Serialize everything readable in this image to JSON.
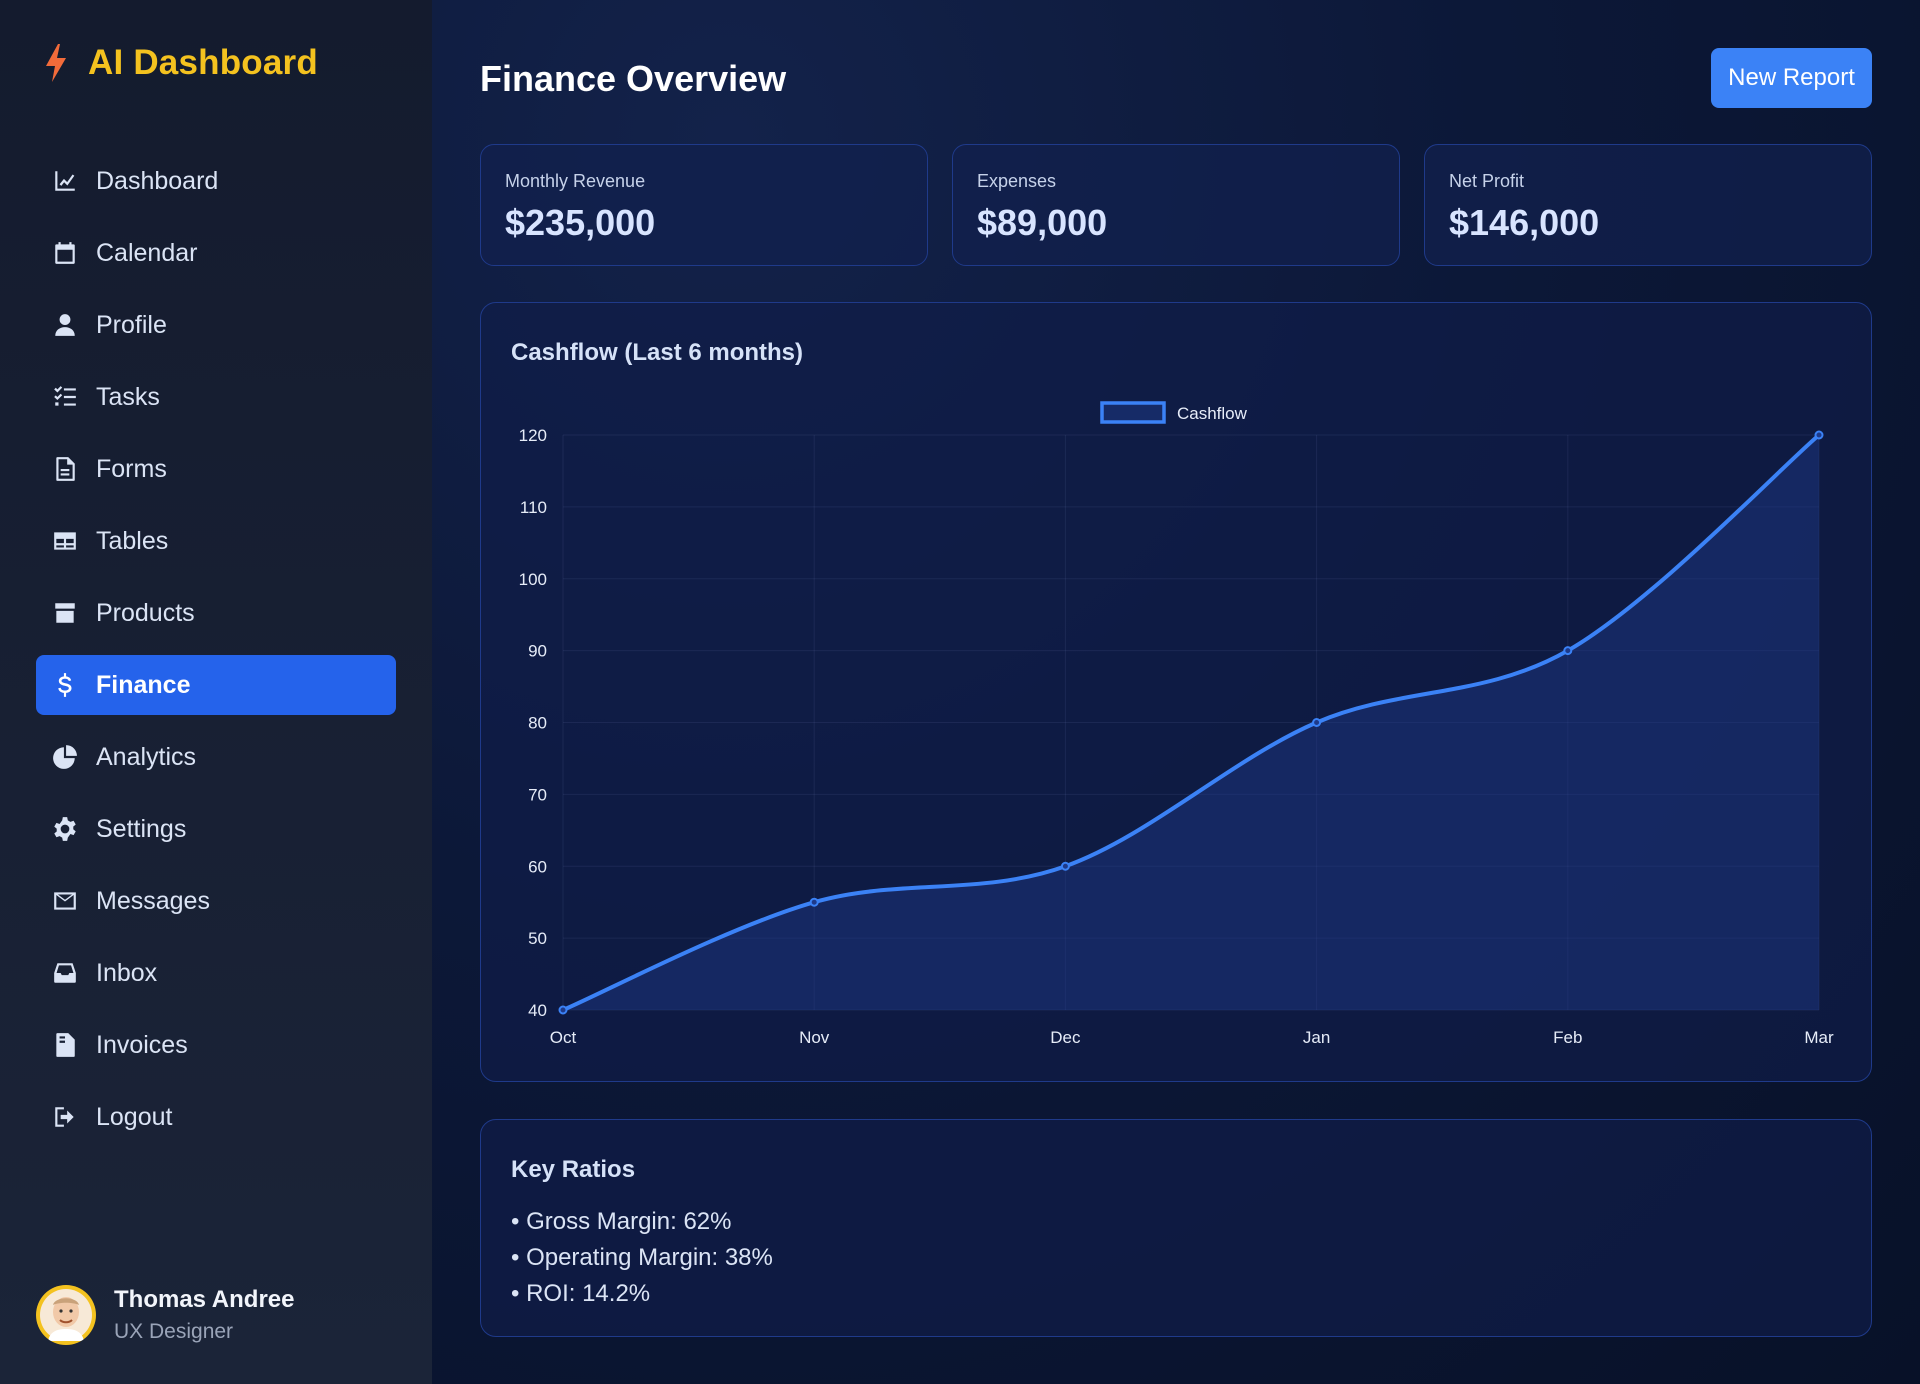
{
  "brand": {
    "title": "AI Dashboard",
    "icon": "bolt-icon",
    "color": "#f4c21f"
  },
  "sidebar": {
    "items": [
      {
        "label": "Dashboard",
        "icon": "chart-line-icon",
        "active": false
      },
      {
        "label": "Calendar",
        "icon": "calendar-icon",
        "active": false
      },
      {
        "label": "Profile",
        "icon": "user-icon",
        "active": false
      },
      {
        "label": "Tasks",
        "icon": "list-check-icon",
        "active": false
      },
      {
        "label": "Forms",
        "icon": "file-icon",
        "active": false
      },
      {
        "label": "Tables",
        "icon": "table-icon",
        "active": false
      },
      {
        "label": "Products",
        "icon": "box-icon",
        "active": false
      },
      {
        "label": "Finance",
        "icon": "dollar-icon",
        "active": true
      },
      {
        "label": "Analytics",
        "icon": "pie-chart-icon",
        "active": false
      },
      {
        "label": "Settings",
        "icon": "gear-icon",
        "active": false
      },
      {
        "label": "Messages",
        "icon": "envelope-icon",
        "active": false
      },
      {
        "label": "Inbox",
        "icon": "inbox-icon",
        "active": false
      },
      {
        "label": "Invoices",
        "icon": "invoice-icon",
        "active": false
      },
      {
        "label": "Logout",
        "icon": "logout-icon",
        "active": false
      }
    ]
  },
  "user": {
    "name": "Thomas Andree",
    "role": "UX Designer"
  },
  "header": {
    "title": "Finance Overview",
    "new_report_label": "New Report"
  },
  "stats": [
    {
      "label": "Monthly Revenue",
      "value": "$235,000"
    },
    {
      "label": "Expenses",
      "value": "$89,000"
    },
    {
      "label": "Net Profit",
      "value": "$146,000"
    }
  ],
  "cashflow_card": {
    "title": "Cashflow (Last 6 months)"
  },
  "chart_data": {
    "type": "area",
    "title": "",
    "categories": [
      "Oct",
      "Nov",
      "Dec",
      "Jan",
      "Feb",
      "Mar"
    ],
    "series": [
      {
        "name": "Cashflow",
        "values": [
          40,
          55,
          60,
          80,
          90,
          120
        ]
      }
    ],
    "ylim": [
      40,
      120
    ],
    "yticks": [
      40,
      50,
      60,
      70,
      80,
      90,
      100,
      110,
      120
    ],
    "grid": true,
    "legend": "top-center",
    "colors": {
      "line": "#3b82f6",
      "fill": "#1e3a8a"
    }
  },
  "ratios": {
    "title": "Key Ratios",
    "items": [
      "• Gross Margin: 62%",
      "• Operating Margin: 38%",
      "• ROI: 14.2%"
    ]
  },
  "colors": {
    "accent": "#2563eb",
    "button": "#3b82f6",
    "card_border": "#1f3a8a"
  }
}
